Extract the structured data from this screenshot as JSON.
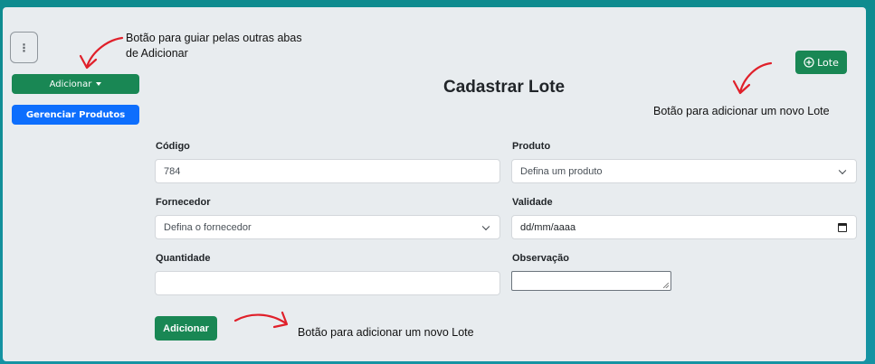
{
  "sidebar": {
    "kebab_glyph": "⋮",
    "adicionar_label": "Adicionar",
    "gerenciar_label": "Gerenciar Produtos"
  },
  "header": {
    "lote_button_label": "Lote",
    "title": "Cadastrar Lote"
  },
  "form": {
    "codigo": {
      "label": "Código",
      "value": "784"
    },
    "produto": {
      "label": "Produto",
      "value": "Defina um produto"
    },
    "fornecedor": {
      "label": "Fornecedor",
      "value": "Defina o fornecedor"
    },
    "validade": {
      "label": "Validade",
      "value": "dd/mm/aaaa"
    },
    "quantidade": {
      "label": "Quantidade",
      "value": ""
    },
    "observacao": {
      "label": "Observação",
      "value": ""
    },
    "submit_label": "Adicionar"
  },
  "annotations": {
    "nav_line1": "Botão para guiar pelas outras abas",
    "nav_line2": "de Adicionar",
    "lote_note": "Botão para adicionar um novo Lote",
    "submit_note": "Botão para adicionar um novo Lote"
  },
  "colors": {
    "success": "#198754",
    "primary": "#0d6efd",
    "annotation_arrow": "#e0202a",
    "background": "#e8ecef"
  }
}
